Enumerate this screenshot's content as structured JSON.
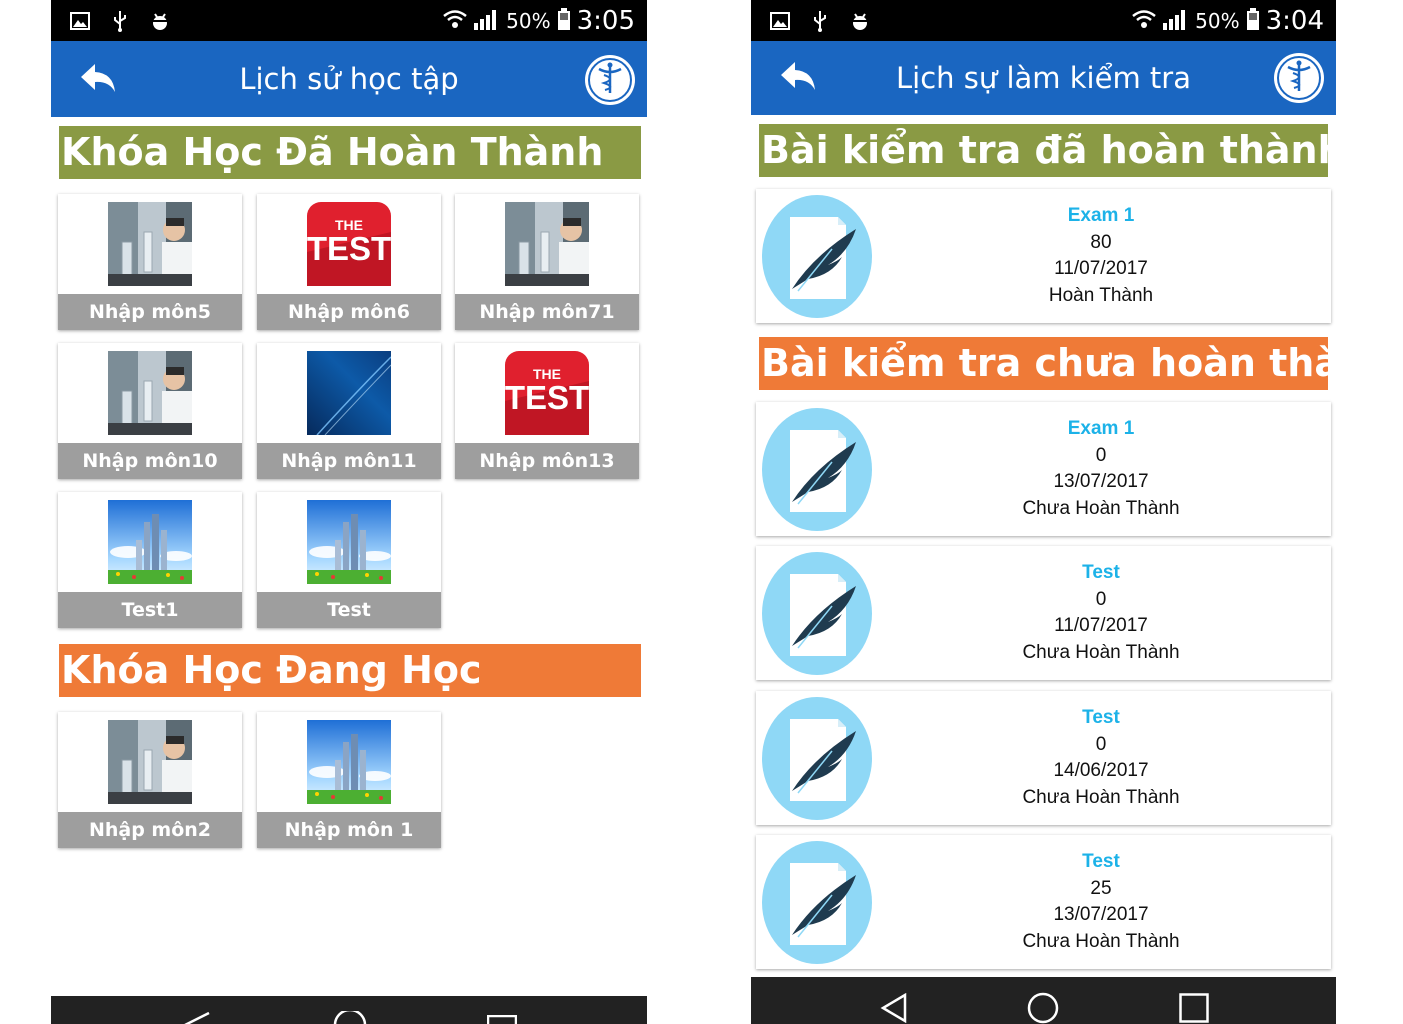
{
  "left": {
    "status": {
      "battery": "50%",
      "clock": "3:05"
    },
    "appbar": {
      "title": "Lịch sử học tập"
    },
    "completed_header": "Khóa Học Đã Hoàn Thành",
    "completed_courses": [
      {
        "label": "Nhập môn5",
        "thumb": "lab-photo"
      },
      {
        "label": "Nhập môn6",
        "thumb": "the-test-logo"
      },
      {
        "label": "Nhập môn71",
        "thumb": "lab-photo"
      },
      {
        "label": "Nhập môn10",
        "thumb": "lab-photo"
      },
      {
        "label": "Nhập môn11",
        "thumb": "blue-abstract"
      },
      {
        "label": "Nhập môn13",
        "thumb": "the-test-logo"
      },
      {
        "label": "Test1",
        "thumb": "city-skyline"
      },
      {
        "label": "Test",
        "thumb": "city-skyline"
      }
    ],
    "in_progress_header": "Khóa Học Đang Học",
    "in_progress_courses": [
      {
        "label": "Nhập môn2",
        "thumb": "lab-photo"
      },
      {
        "label": "Nhập môn 1",
        "thumb": "city-skyline"
      }
    ],
    "test_logo": {
      "small": "THE",
      "big": "TEST"
    }
  },
  "right": {
    "status": {
      "battery": "50%",
      "clock": "3:04"
    },
    "appbar": {
      "title": "Lịch sự làm kiểm tra"
    },
    "completed_header": "Bài kiểm tra đã hoàn thành",
    "completed_exams": [
      {
        "title": "Exam 1",
        "score": "80",
        "date": "11/07/2017",
        "status": "Hoàn Thành"
      }
    ],
    "incomplete_header": "Bài kiểm tra chưa hoàn thành",
    "incomplete_exams": [
      {
        "title": "Exam 1",
        "score": "0",
        "date": "13/07/2017",
        "status": "Chưa Hoàn Thành"
      },
      {
        "title": "Test",
        "score": "0",
        "date": "11/07/2017",
        "status": "Chưa Hoàn Thành"
      },
      {
        "title": "Test",
        "score": "0",
        "date": "14/06/2017",
        "status": "Chưa Hoàn Thành"
      },
      {
        "title": "Test",
        "score": "25",
        "date": "13/07/2017",
        "status": "Chưa Hoàn Thành"
      }
    ]
  },
  "colors": {
    "appbar": "#1a66c1",
    "header_green": "#8a9a44",
    "header_orange": "#ef7a37",
    "exam_title": "#1cb2e8",
    "icon_circle": "#8fd8f6"
  }
}
